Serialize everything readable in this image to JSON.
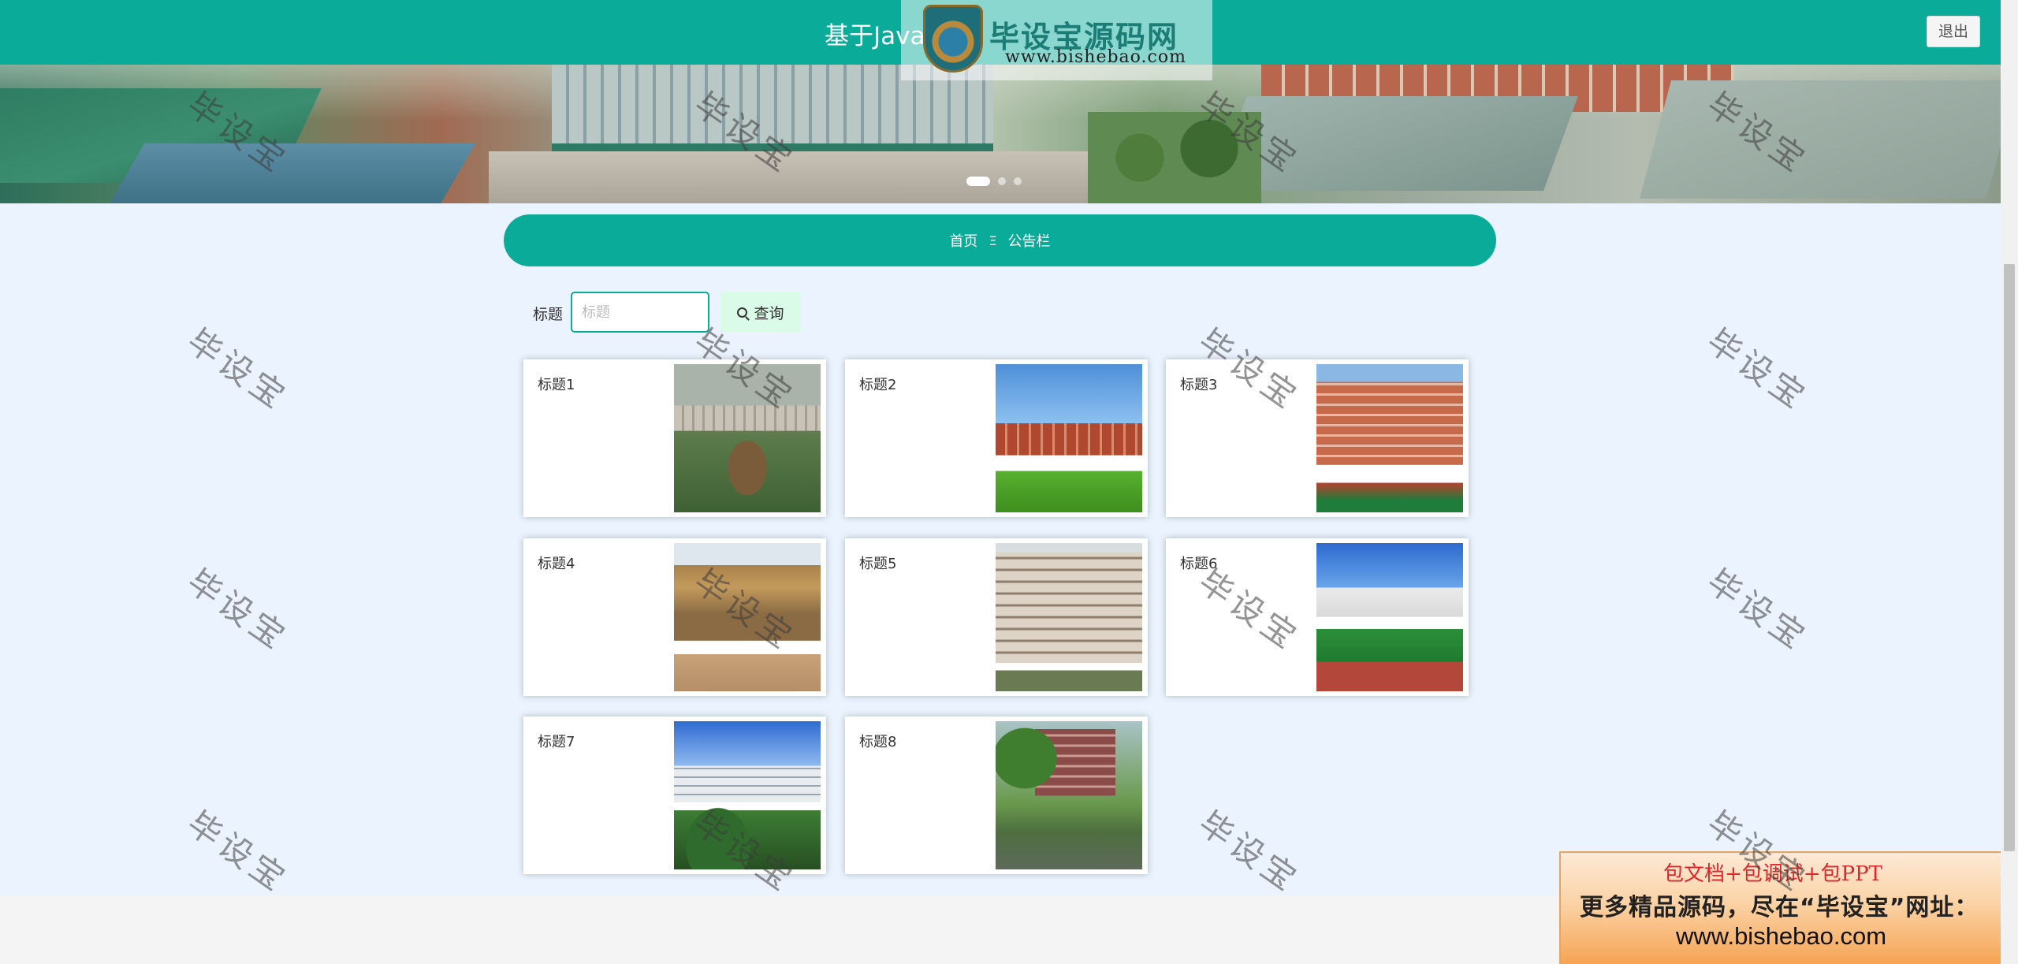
{
  "header": {
    "title": "基于Java的",
    "logout_label": "退出",
    "logo_text": "毕设宝源码网",
    "logo_url": "www.bishebao.com"
  },
  "banner": {
    "slide_count": 3,
    "active_slide": 1
  },
  "breadcrumb": {
    "home": "首页",
    "separator": "Ξ",
    "current": "公告栏"
  },
  "search": {
    "label": "标题",
    "placeholder": "标题",
    "value": "",
    "button_label": "查询",
    "button_icon": "search-icon"
  },
  "cards": [
    {
      "title": "标题1",
      "image": "campus-garden-pavilion"
    },
    {
      "title": "标题2",
      "image": "red-brick-building-lawn"
    },
    {
      "title": "标题3",
      "image": "orange-school-building-track"
    },
    {
      "title": "标题4",
      "image": "classical-hall"
    },
    {
      "title": "标题5",
      "image": "white-dormitory-building"
    },
    {
      "title": "标题6",
      "image": "modern-building-football-field"
    },
    {
      "title": "标题7",
      "image": "white-campus-building-trees"
    },
    {
      "title": "标题8",
      "image": "brick-buildings-pond"
    }
  ],
  "promo": {
    "line1": "包文档+包调试+包PPT",
    "line2": "更多精品源码，尽在“毕设宝”网址：",
    "line3": "www.bishebao.com"
  },
  "watermark_text": "毕设宝",
  "colors": {
    "primary": "#0aab98",
    "page_bg": "#eaf3fe",
    "search_btn_bg": "#d9fbe7",
    "promo_red": "#e0262a"
  }
}
